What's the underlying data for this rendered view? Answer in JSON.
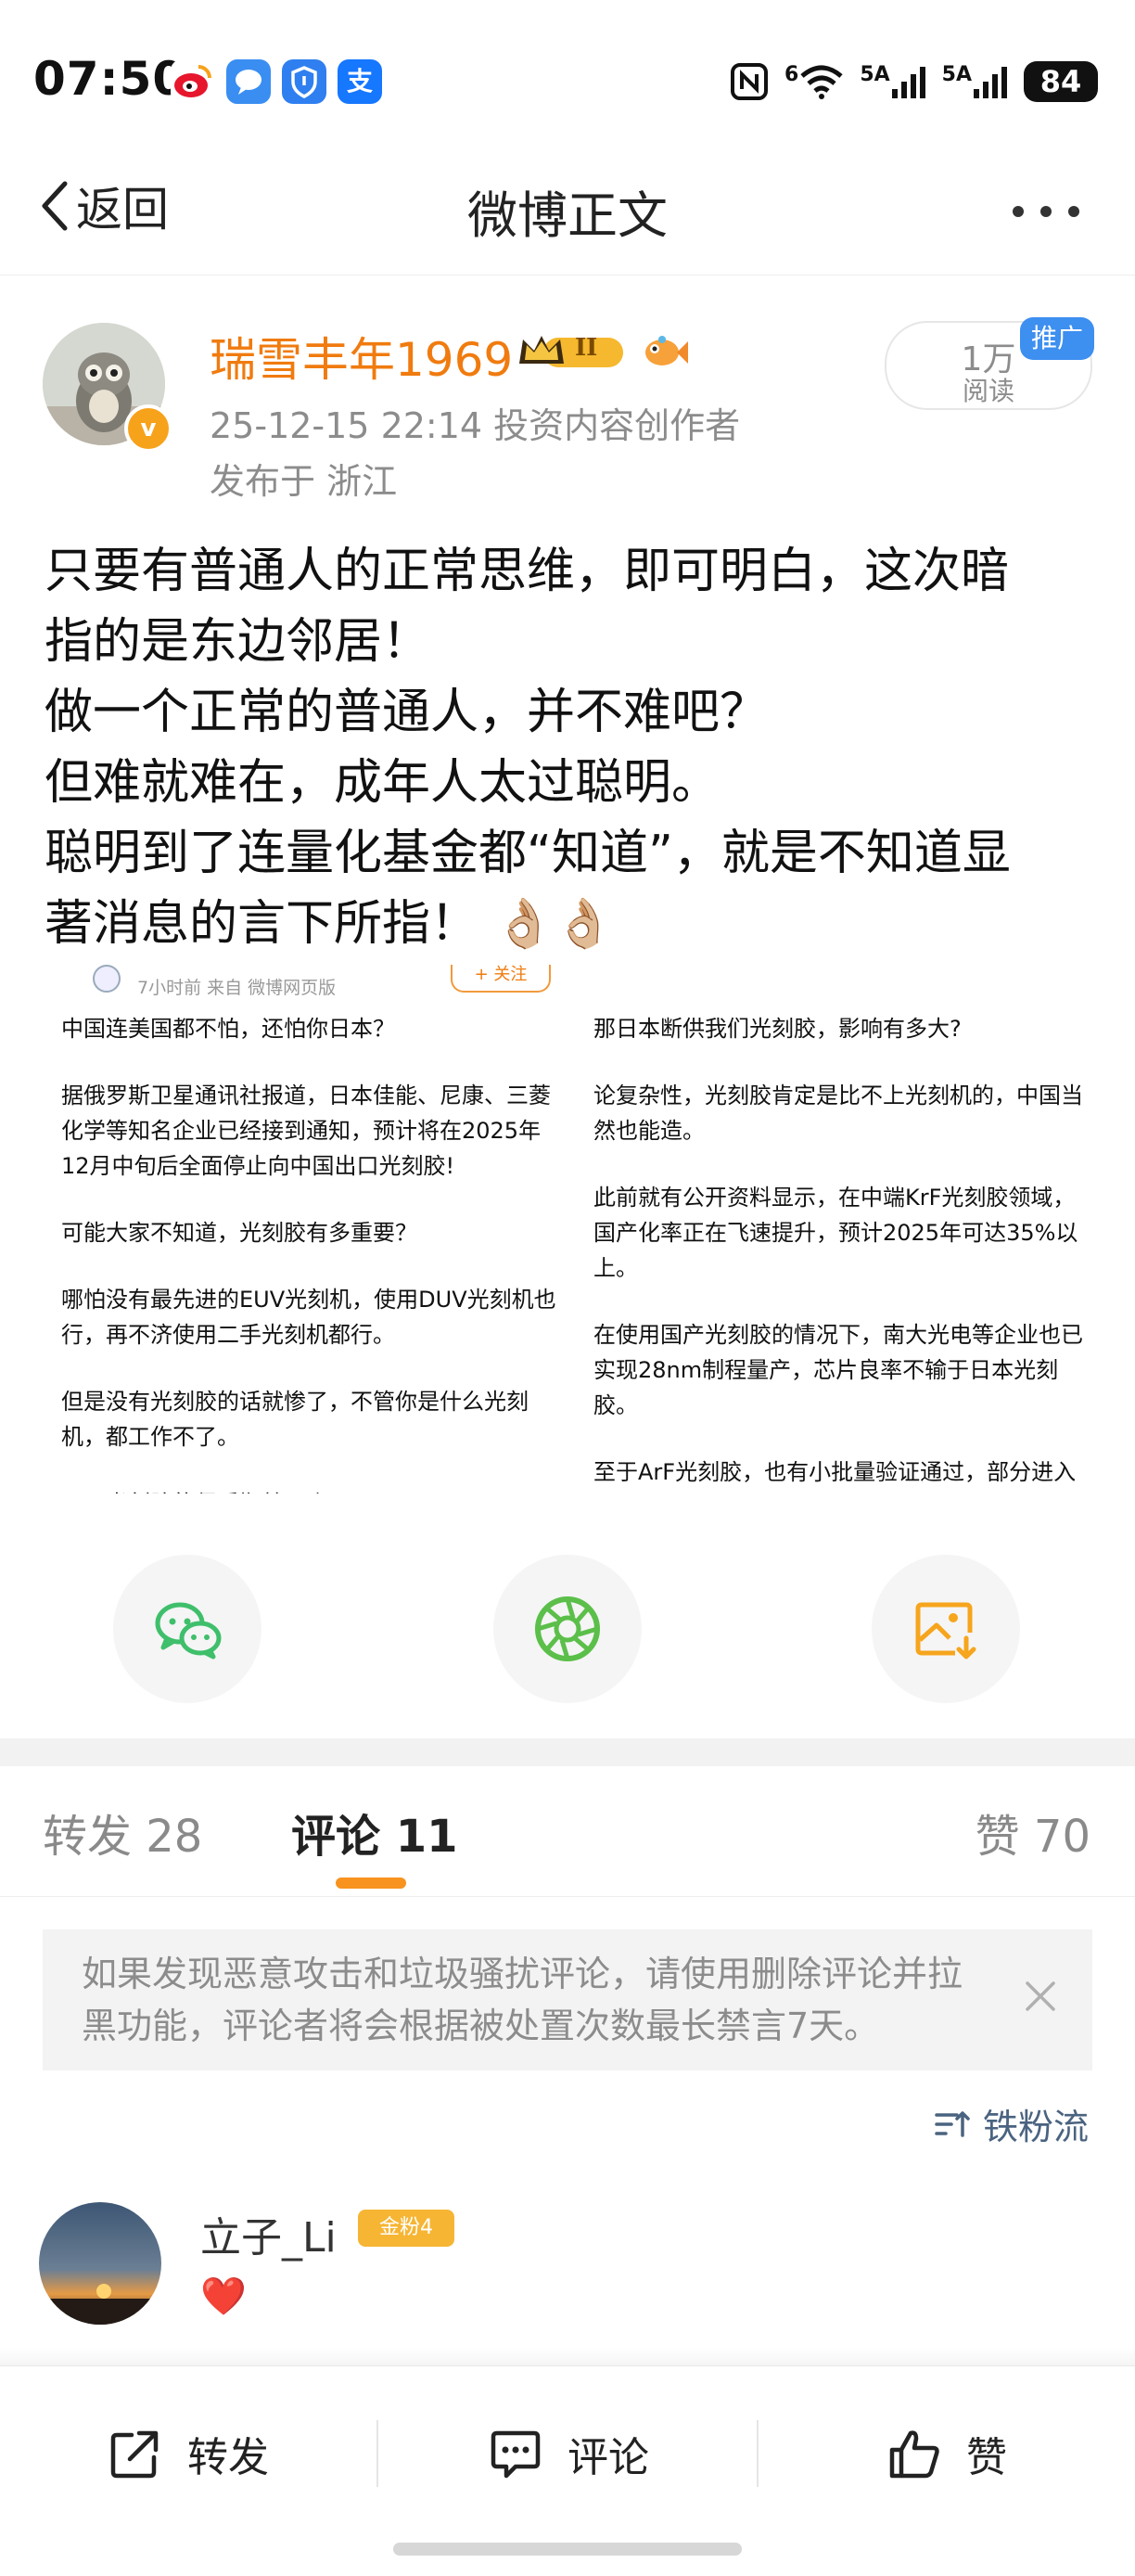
{
  "status_bar": {
    "time": "07:50",
    "apps": [
      "weibo",
      "message",
      "shield",
      "支"
    ],
    "network_1": "5A",
    "network_2": "5A",
    "wifi_label": "6",
    "battery": "84"
  },
  "nav": {
    "back_label": "返回",
    "title": "微博正文"
  },
  "post": {
    "author": "瑞雪丰年1969",
    "vip_level": "II",
    "meta": "25-12-15 22:14  投资内容创作者",
    "location": "发布于 浙江",
    "reads_count": "1万",
    "reads_label": "阅读",
    "promo": "推广",
    "body_lines": [
      "只要有普通人的正常思维，即可明白，这次暗",
      "指的是东边邻居！",
      "做一个正常的普通人，并不难吧？",
      "但难就难在，成年人太过聪明。",
      "聪明到了连量化基金都“知道”，就是不知道显",
      "著消息的言下所指！ 👌🏼👌🏼"
    ]
  },
  "embed": {
    "time": "7小时前 来自 微博网页版",
    "follow": "+ 关注",
    "left_paragraphs": [
      "中国连美国都不怕，还怕你日本？",
      "据俄罗斯卫星通讯社报道，日本佳能、尼康、三菱化学等知名企业已经接到通知，预计将在2025年12月中旬后全面停止向中国出口光刻胶!",
      "可能大家不知道，光刻胶有多重要？",
      "哪怕没有最先进的EUV光刻机，使用DUV光刻机也行，再不济使用二手光刻机都行。",
      "但是没有光刻胶的话就惨了，不管你是什么光刻机，都工作不了。",
      "而且光刻胶的保质期就几个月"
    ],
    "right_paragraphs": [
      "那日本断供我们光刻胶，影响有多大?",
      "论复杂性，光刻胶肯定是比不上光刻机的，中国当然也能造。",
      "此前就有公开资料显示，在中端KrF光刻胶领域，国产化率正在飞速提升，预计2025年可达35%以上。",
      "在使用国产光刻胶的情况下，南大光电等企业也已实现28nm制程量产，芯片良率不输于日本光刻胶。",
      "至于ArF光刻胶，也有小批量验证通过，部分进入头部晶圆厂供应链"
    ]
  },
  "tabs": {
    "repost": "转发 28",
    "comment": "评论 11",
    "like": "赞 70"
  },
  "notice": {
    "text": "如果发现恶意攻击和垃圾骚扰评论，请使用删除评论并拉黑功能，评论者将会根据被处置次数最长禁言7天。"
  },
  "sort": {
    "label": "铁粉流"
  },
  "comment": {
    "user": "立子_Li",
    "badge": "金粉4",
    "content": "❤️"
  },
  "bottom_bar": {
    "repost": "转发",
    "comment": "评论",
    "like": "赞"
  },
  "colors": {
    "accent": "#f7931e",
    "author_name": "#f07b0f",
    "wechat": "#3fbf6b",
    "moments": "#5bbf4a",
    "save_image": "#f6a51d",
    "promo": "#3d8ff0"
  }
}
